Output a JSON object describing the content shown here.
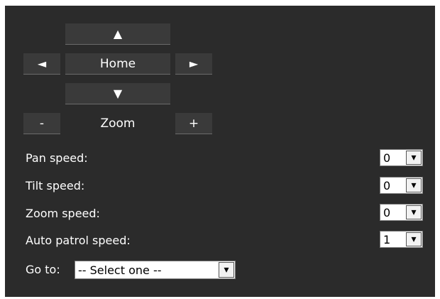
{
  "ptz": {
    "up_icon": "▲",
    "down_icon": "▼",
    "left_icon": "◄",
    "right_icon": "►",
    "home_label": "Home",
    "zoom_out_label": "-",
    "zoom_label": "Zoom",
    "zoom_in_label": "+"
  },
  "speeds": [
    {
      "label": "Pan speed:",
      "value": "0"
    },
    {
      "label": "Tilt speed:",
      "value": "0"
    },
    {
      "label": "Zoom speed:",
      "value": "0"
    },
    {
      "label": "Auto patrol speed:",
      "value": "1"
    }
  ],
  "goto": {
    "label": "Go to:",
    "value": "-- Select one --"
  },
  "icons": {
    "dropdown": "chevron-down-icon"
  },
  "colors": {
    "panel_bg": "#2b2b2b",
    "button_bg": "#3a3a3a",
    "text": "#ffffff"
  }
}
